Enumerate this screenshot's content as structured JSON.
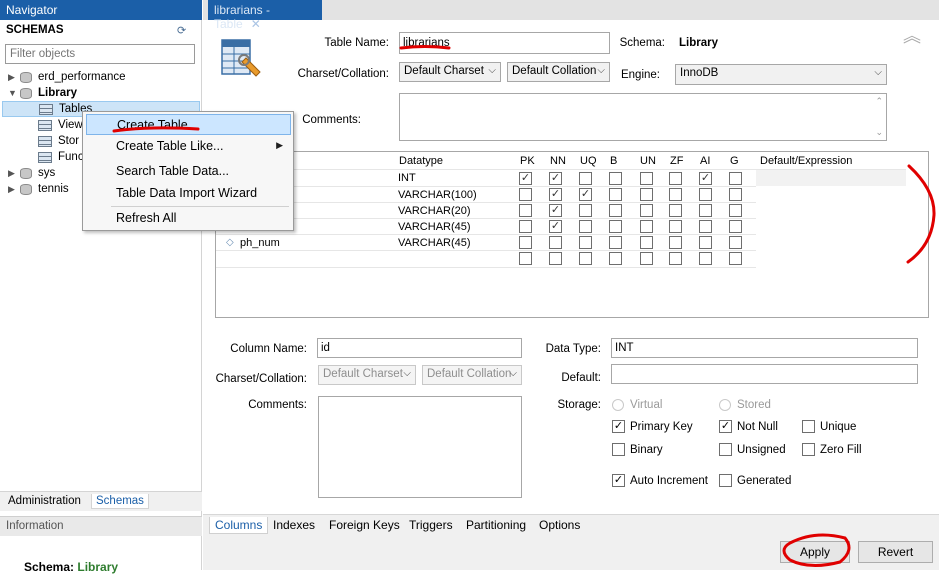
{
  "navigator": {
    "title": "Navigator",
    "schemas_label": "SCHEMAS",
    "filter_placeholder": "Filter objects",
    "tree": {
      "erd": "erd_performance",
      "library": "Library",
      "tables": "Tables",
      "views": "View",
      "stored": "Stor",
      "functions": "Func",
      "sys": "sys",
      "tennis": "tennis"
    },
    "tabs": {
      "administration": "Administration",
      "schemas": "Schemas"
    },
    "information": "Information",
    "info_schema_label": "Schema:",
    "info_schema_value": "Library"
  },
  "context_menu": {
    "create_table": "Create Table...",
    "create_table_like": "Create Table Like...",
    "search_table_data": "Search Table Data...",
    "import_wizard": "Table Data Import Wizard",
    "refresh_all": "Refresh All"
  },
  "editor": {
    "tab_title": "librarians - Table",
    "table_name_label": "Table Name:",
    "table_name": "librarians",
    "schema_label": "Schema:",
    "schema": "Library",
    "charset_label": "Charset/Collation:",
    "charset": "Default Charset",
    "collation": "Default Collation",
    "engine_label": "Engine:",
    "engine": "InnoDB",
    "comments_label": "Comments:"
  },
  "grid": {
    "headers": {
      "datatype": "Datatype",
      "pk": "PK",
      "nn": "NN",
      "uq": "UQ",
      "b": "B",
      "un": "UN",
      "zf": "ZF",
      "ai": "AI",
      "g": "G",
      "default": "Default/Expression"
    },
    "rows": [
      {
        "name": "",
        "type": "INT",
        "pk": true,
        "nn": true,
        "uq": false,
        "ai": true
      },
      {
        "name": "",
        "type": "VARCHAR(100)",
        "pk": false,
        "nn": true,
        "uq": true,
        "ai": false
      },
      {
        "name": "",
        "type": "VARCHAR(20)",
        "pk": false,
        "nn": true,
        "uq": false,
        "ai": false
      },
      {
        "name": "",
        "type": "VARCHAR(45)",
        "pk": false,
        "nn": true,
        "uq": false,
        "ai": false
      },
      {
        "name": "ph_num",
        "type": "VARCHAR(45)",
        "pk": false,
        "nn": false,
        "uq": false,
        "ai": false
      },
      {
        "name": "",
        "type": "",
        "pk": false,
        "nn": false,
        "uq": false,
        "ai": false
      }
    ]
  },
  "details": {
    "column_name_label": "Column Name:",
    "column_name": "id",
    "charset_label": "Charset/Collation:",
    "charset": "Default Charset",
    "collation": "Default Collation",
    "comments_label": "Comments:",
    "data_type_label": "Data Type:",
    "data_type": "INT",
    "default_label": "Default:",
    "storage_label": "Storage:",
    "virtual": "Virtual",
    "stored": "Stored",
    "primary_key": "Primary Key",
    "not_null": "Not Null",
    "unique": "Unique",
    "binary": "Binary",
    "unsigned": "Unsigned",
    "zero_fill": "Zero Fill",
    "auto_increment": "Auto Increment",
    "generated": "Generated"
  },
  "bottom_tabs": [
    "Columns",
    "Indexes",
    "Foreign Keys",
    "Triggers",
    "Partitioning",
    "Options"
  ],
  "buttons": {
    "apply": "Apply",
    "revert": "Revert"
  },
  "colors": {
    "accent": "#1b5fa8",
    "annotation": "#e00000",
    "selection": "#cce6ff"
  }
}
